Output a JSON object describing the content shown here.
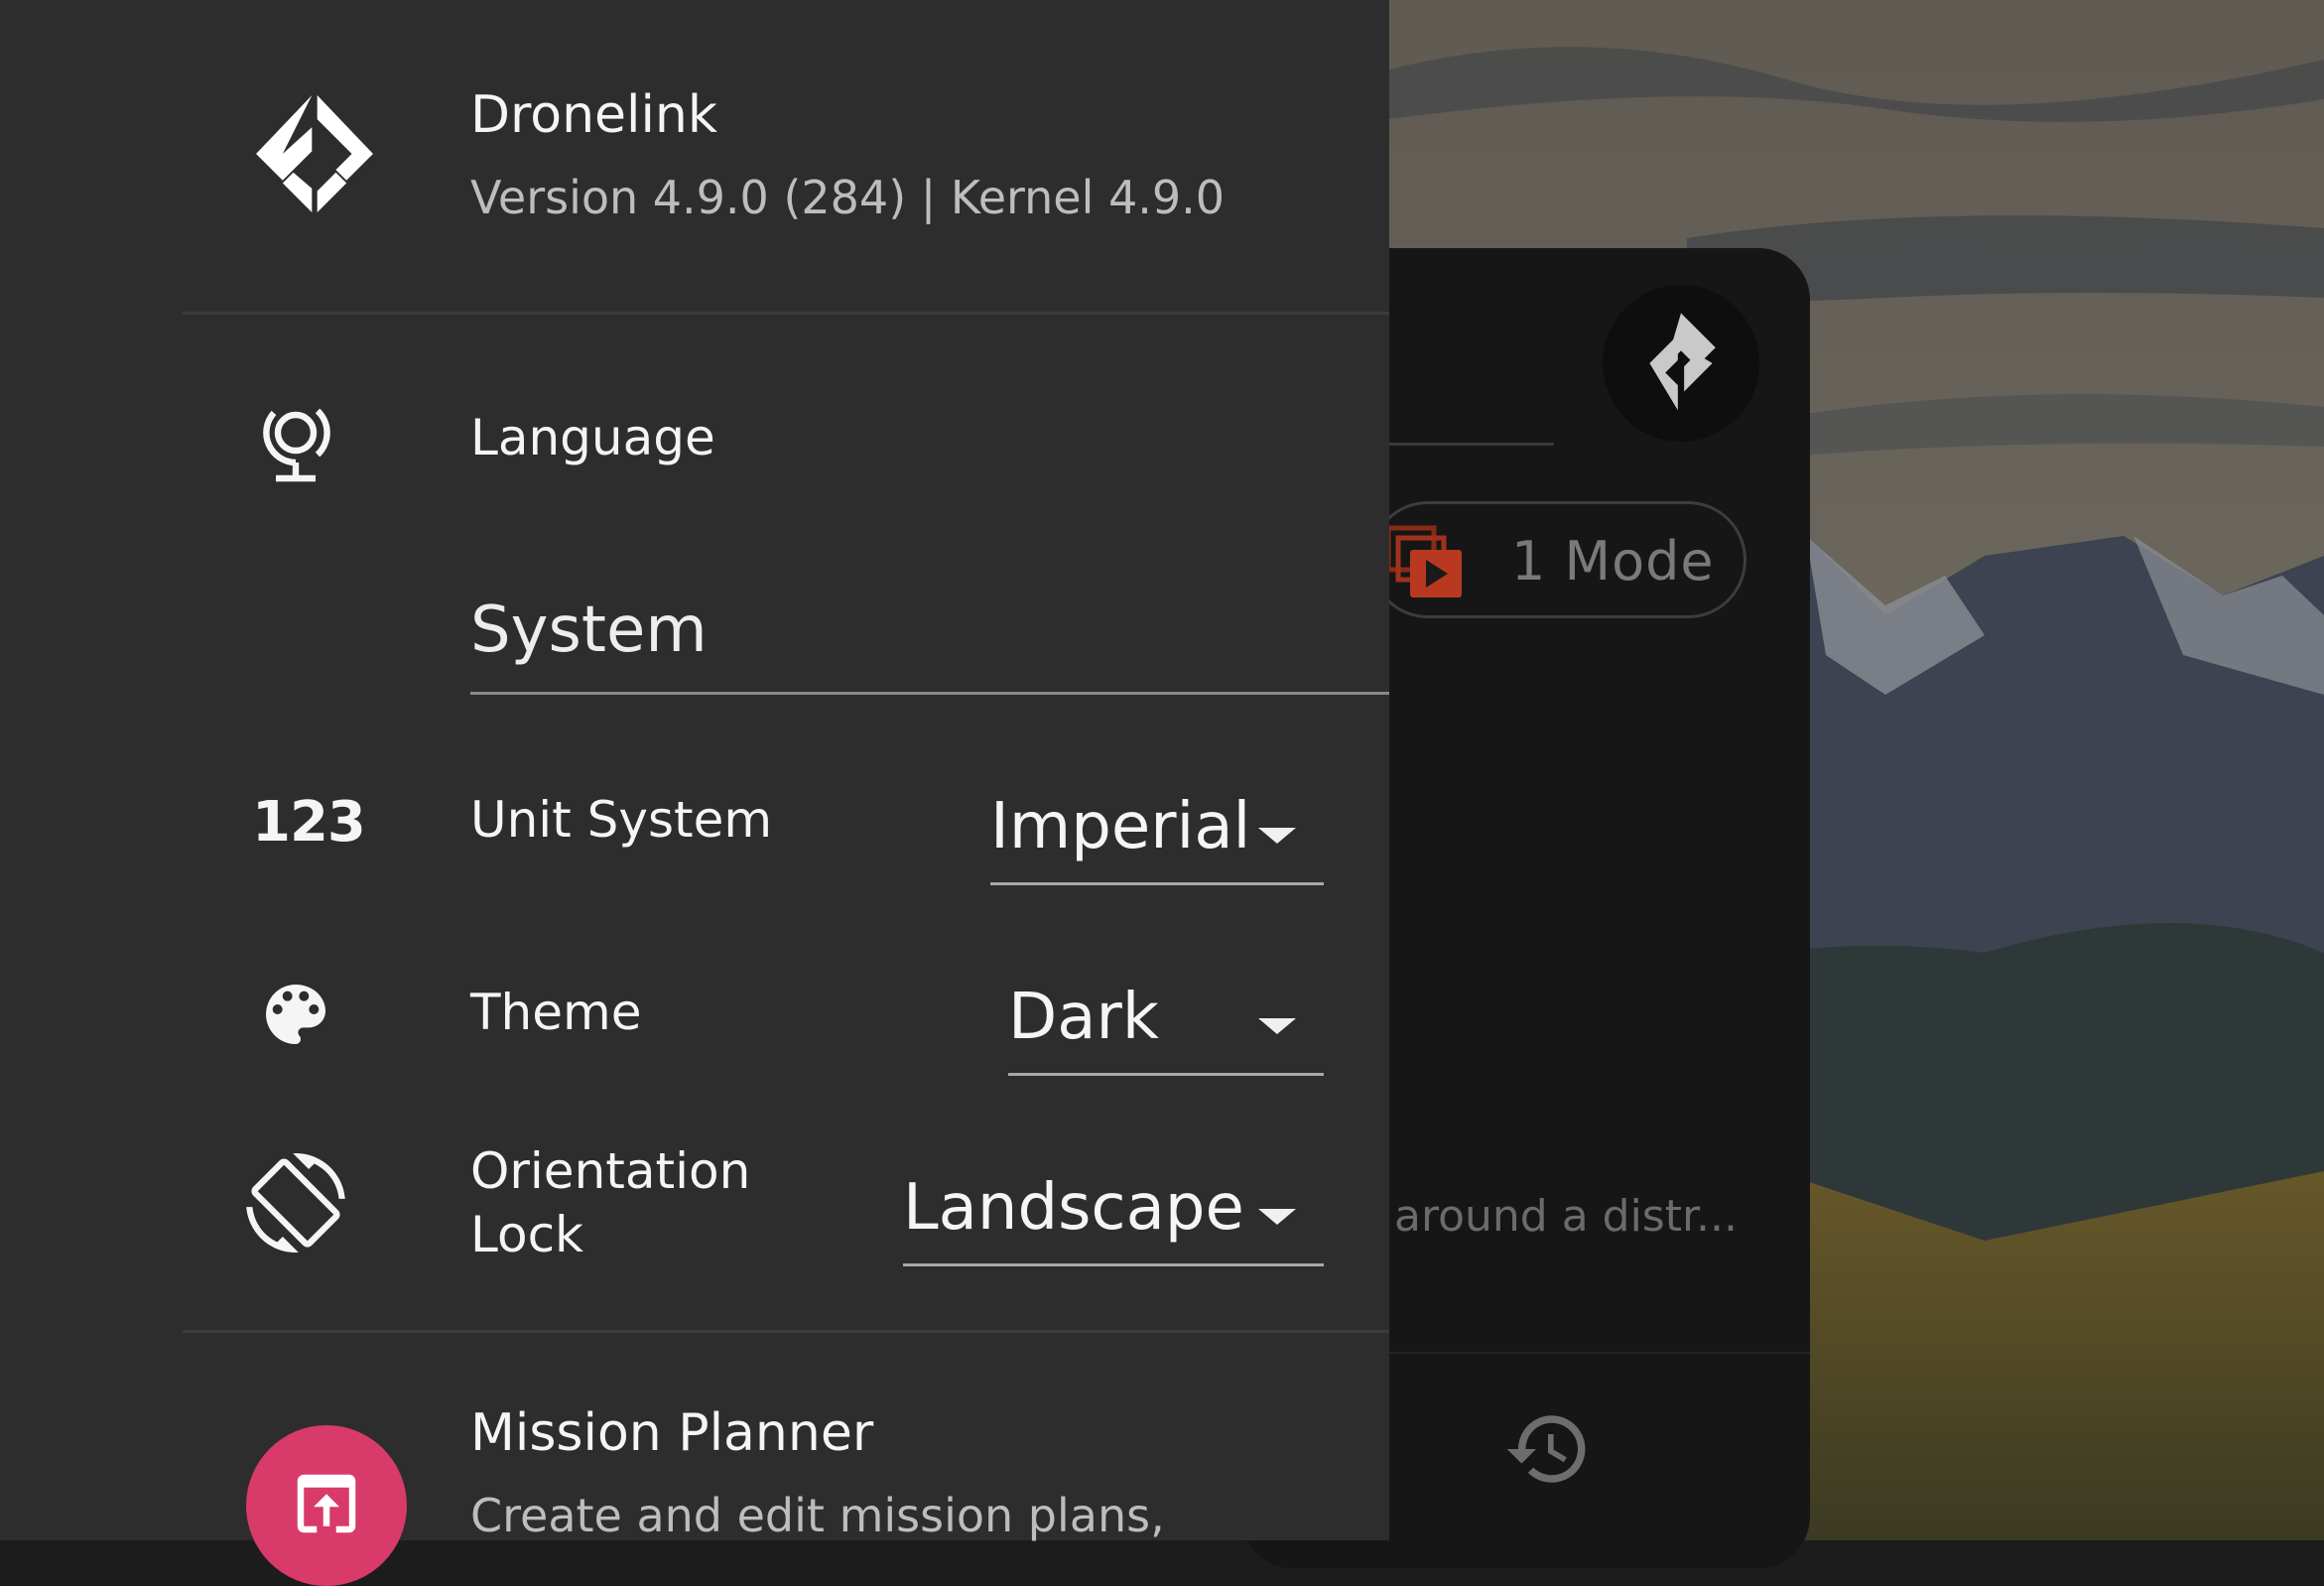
{
  "app": {
    "name": "Dronelink",
    "version": "Version 4.9.0 (284) | Kernel 4.9.0",
    "logo_icon": "dronelink-logo-icon"
  },
  "settings": {
    "language": {
      "label": "Language",
      "icon": "globe-icon"
    },
    "system_section": "System",
    "unit_system": {
      "label": "Unit System",
      "icon_text": "123",
      "value": "Imperial"
    },
    "theme": {
      "label": "Theme",
      "icon": "palette-icon",
      "value": "Dark"
    },
    "orientation_lock": {
      "label_line1": "Orientation",
      "label_line2": "Lock",
      "icon": "screen-rotation-icon",
      "value": "Landscape"
    }
  },
  "mission_planner": {
    "title": "Mission Planner",
    "description": "Create and edit mission plans,",
    "icon": "mission-upload-icon",
    "accent_color": "#d83a6a"
  },
  "background_card": {
    "mode_label": "1 Mode",
    "description": "around a distr...",
    "history_icon": "history-icon"
  },
  "colors": {
    "drawer_bg": "#2d2d2d",
    "text_primary": "#f5f5f5",
    "text_secondary": "#bdbdbd"
  }
}
